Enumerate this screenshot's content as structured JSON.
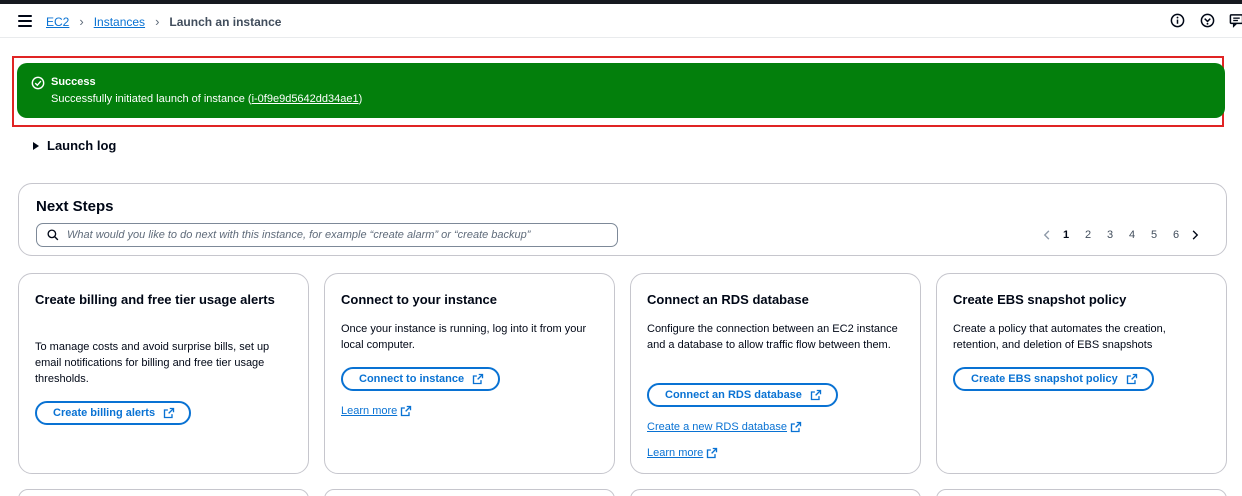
{
  "breadcrumb": {
    "items": [
      {
        "label": "EC2"
      },
      {
        "label": "Instances"
      },
      {
        "label": "Launch an instance"
      }
    ]
  },
  "header": {
    "icons": [
      "info-icon",
      "notifications-icon",
      "feedback-icon"
    ]
  },
  "flash": {
    "title": "Success",
    "message_prefix": "Successfully initiated launch of instance (",
    "instance_id": "i-0f9e9d5642dd34ae1",
    "message_suffix": ")",
    "color": "#037f0c"
  },
  "launch_log": {
    "label": "Launch log"
  },
  "next_steps": {
    "title": "Next Steps",
    "search_placeholder": "What would you like to do next with this instance, for example “create alarm” or “create backup”",
    "pages": [
      "1",
      "2",
      "3",
      "4",
      "5",
      "6"
    ],
    "current_page": "1"
  },
  "cards": [
    {
      "title": "Create billing and free tier usage alerts",
      "description": "To manage costs and avoid surprise bills, set up email notifications for billing and free tier usage thresholds.",
      "button": "Create billing alerts"
    },
    {
      "title": "Connect to your instance",
      "description": "Once your instance is running, log into it from your local computer.",
      "button": "Connect to instance",
      "link": "Learn more"
    },
    {
      "title": "Connect an RDS database",
      "description": "Configure the connection between an EC2 instance and a database to allow traffic flow between them.",
      "button": "Connect an RDS database",
      "link": "Create a new RDS database",
      "link2": "Learn more"
    },
    {
      "title": "Create EBS snapshot policy",
      "description": "Create a policy that automates the creation, retention, and deletion of EBS snapshots",
      "button": "Create EBS snapshot policy"
    }
  ],
  "colors": {
    "accent": "#0972d3",
    "success": "#037f0c",
    "highlight_outline": "#e02424"
  }
}
